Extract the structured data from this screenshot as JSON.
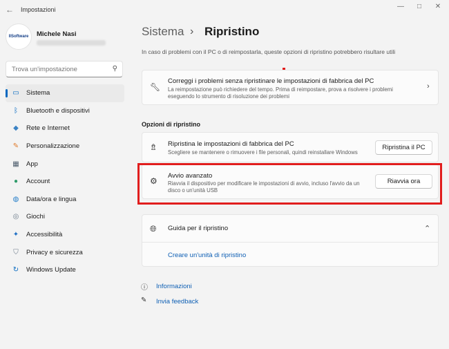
{
  "window": {
    "title": "Impostazioni",
    "back_glyph": "←",
    "minimize_glyph": "—",
    "maximize_glyph": "□",
    "close_glyph": "✕"
  },
  "profile": {
    "name": "Michele Nasi",
    "avatar_text": "IlSoftware"
  },
  "search": {
    "placeholder": "Trova un'impostazione",
    "icon": "search-icon"
  },
  "sidebar": {
    "items": [
      {
        "label": "Sistema",
        "icon": "monitor-icon",
        "glyph": "▭",
        "color": "#0067c0",
        "active": true
      },
      {
        "label": "Bluetooth e dispositivi",
        "icon": "bluetooth-icon",
        "glyph": "ᛒ",
        "color": "#0067c0"
      },
      {
        "label": "Rete e Internet",
        "icon": "wifi-icon",
        "glyph": "◆",
        "color": "#3b82c4"
      },
      {
        "label": "Personalizzazione",
        "icon": "brush-icon",
        "glyph": "✎",
        "color": "#e07b2b"
      },
      {
        "label": "App",
        "icon": "apps-icon",
        "glyph": "▦",
        "color": "#4a5a6a"
      },
      {
        "label": "Account",
        "icon": "person-icon",
        "glyph": "●",
        "color": "#2e9b6a"
      },
      {
        "label": "Data/ora e lingua",
        "icon": "globe-clock-icon",
        "glyph": "◍",
        "color": "#1f7bc8"
      },
      {
        "label": "Giochi",
        "icon": "gamepad-icon",
        "glyph": "◎",
        "color": "#6b7a89"
      },
      {
        "label": "Accessibilità",
        "icon": "accessibility-icon",
        "glyph": "✦",
        "color": "#1f6fc4"
      },
      {
        "label": "Privacy e sicurezza",
        "icon": "shield-icon",
        "glyph": "⛉",
        "color": "#6b7a89"
      },
      {
        "label": "Windows Update",
        "icon": "update-icon",
        "glyph": "↻",
        "color": "#0067c0"
      }
    ]
  },
  "header": {
    "section": "Sistema",
    "separator": "›",
    "page": "Ripristino"
  },
  "description": "In caso di problemi con il PC o di reimpostarla, queste opzioni di ripristino potrebbero risultare utili",
  "troubleshoot_card": {
    "title": "Correggi i problemi senza ripristinare le impostazioni di fabbrica del PC",
    "subtitle": "La reimpostazione può richiedere del tempo. Prima di reimpostare, prova a risolvere i problemi eseguendo lo strumento di risoluzione dei problemi",
    "icon": "wrench-icon",
    "chevron": "›"
  },
  "recovery_options": {
    "heading": "Opzioni di ripristino",
    "reset": {
      "title": "Ripristina le impostazioni di fabbrica del PC",
      "subtitle": "Scegliere se mantenere o rimuovere i file personali, quindi reinstallare Windows",
      "button": "Ripristina il PC",
      "icon": "reset-pc-icon"
    },
    "advanced": {
      "title": "Avvio avanzato",
      "subtitle": "Riavvia il dispositivo per modificare le impostazioni di avvio, incluso l'avvio da un disco o un'unità USB",
      "button": "Riavvia ora",
      "icon": "advanced-startup-icon"
    }
  },
  "guide": {
    "title": "Guida per il ripristino",
    "chevron": "⌃",
    "link": "Creare un'unità di ripristino",
    "icon": "globe-icon"
  },
  "footer_links": [
    {
      "label": "Informazioni",
      "icon": "info-icon"
    },
    {
      "label": "Invia feedback",
      "icon": "feedback-icon"
    }
  ],
  "colors": {
    "accent": "#0067c0",
    "highlight": "#e11d1d",
    "link": "#0e5fb4"
  }
}
